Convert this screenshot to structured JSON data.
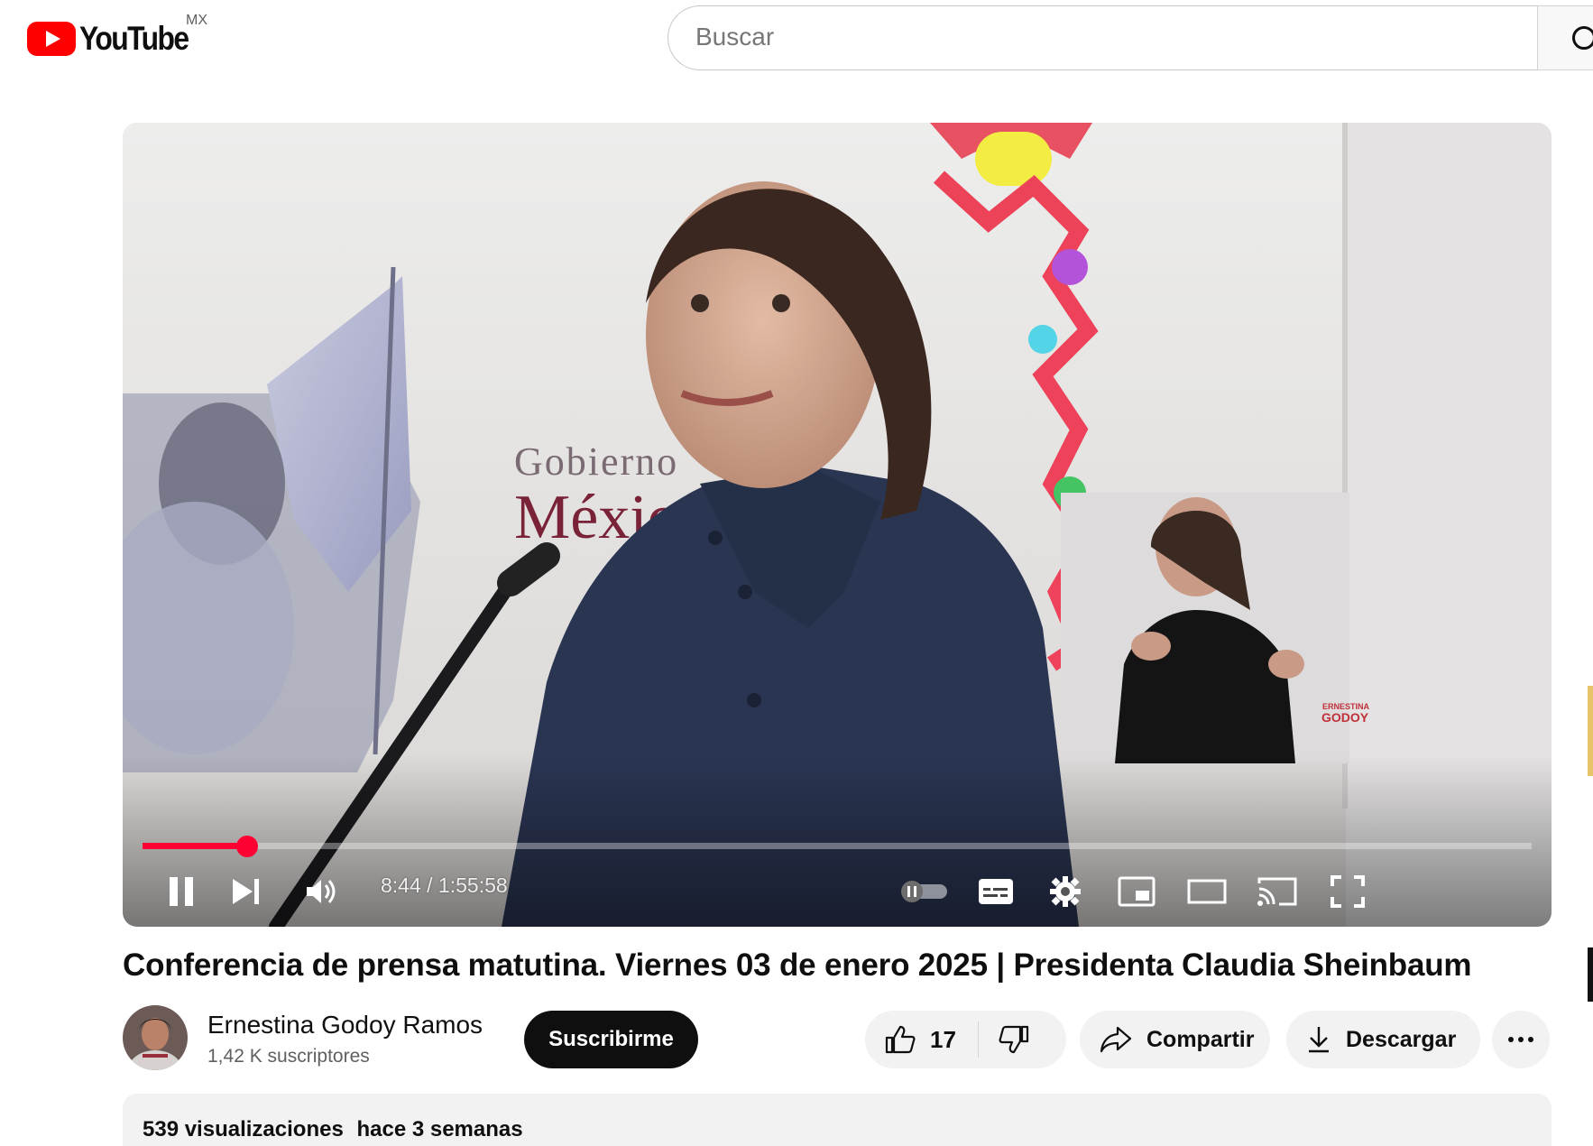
{
  "header": {
    "logo_text": "YouTube",
    "region": "MX",
    "search_placeholder": "Buscar"
  },
  "player": {
    "time_display": "8:44 / 1:55:58",
    "progress_fraction": 0.0754,
    "watermark_line1": "ERNESTINA",
    "watermark_line2": "GODOY",
    "scene_text_1": "Gobierno",
    "scene_text_2": "México"
  },
  "video": {
    "title": "Conferencia de prensa matutina. Viernes 03 de enero 2025 | Presidenta Claudia Sheinbaum"
  },
  "channel": {
    "name": "Ernestina Godoy Ramos",
    "subscribers": "1,42 K suscriptores",
    "subscribe_label": "Suscribirme"
  },
  "actions": {
    "like_count": "17",
    "share_label": "Compartir",
    "download_label": "Descargar"
  },
  "description": {
    "views": "539 visualizaciones",
    "date": "hace 3 semanas"
  },
  "colors": {
    "brand_red": "#ff0000",
    "progress_red": "#ff0033",
    "subscribe_bg": "#0f0f0f",
    "pill_bg": "#f2f2f2"
  },
  "icons": {
    "pause": "pause-icon",
    "next": "next-icon",
    "volume": "volume-icon",
    "autoplay": "autoplay-toggle",
    "captions": "captions-icon",
    "settings": "gear-icon",
    "miniplayer": "miniplayer-icon",
    "theater": "theater-icon",
    "cast": "cast-icon",
    "fullscreen": "fullscreen-icon",
    "like": "thumbs-up-icon",
    "dislike": "thumbs-down-icon",
    "share": "share-arrow-icon",
    "download": "download-icon",
    "more": "more-horizontal-icon",
    "search": "search-icon"
  }
}
